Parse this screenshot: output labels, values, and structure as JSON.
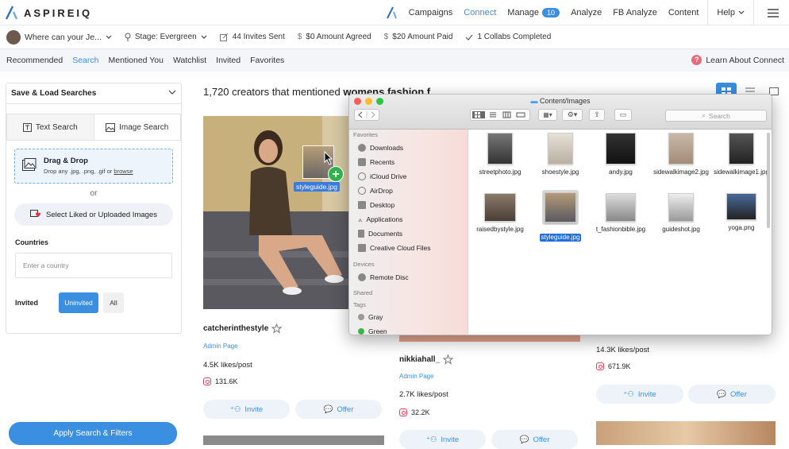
{
  "brand": {
    "name": "ASPIREIQ",
    "accent": "#3a8fe0"
  },
  "nav": {
    "items": [
      {
        "label": "Campaigns",
        "active": false
      },
      {
        "label": "Connect",
        "active": true
      },
      {
        "label": "Manage",
        "badge": "10"
      },
      {
        "label": "Analyze"
      },
      {
        "label": "FB Analyze"
      },
      {
        "label": "Content"
      },
      {
        "label": "Help"
      }
    ]
  },
  "subbar": {
    "campaign": "Where can your Je...",
    "stage": "Stage: Evergreen",
    "invites": "44 Invites Sent",
    "agreed": "$0 Amount Agreed",
    "paid": "$20 Amount Paid",
    "collabs": "1 Collabs Completed"
  },
  "tabs": [
    "Recommended",
    "Search",
    "Mentioned You",
    "Watchlist",
    "Invited",
    "Favorites"
  ],
  "active_tab": "Search",
  "learn": "Learn About Connect",
  "left": {
    "save_load": "Save & Load Searches",
    "text_search": "Text Search",
    "image_search": "Image Search",
    "drop_title": "Drag & Drop",
    "drop_sub": "Drop any .jpg, .png, .gif or",
    "drop_link": "browse",
    "or": "or",
    "select_btn": "Select Liked or Uploaded Images",
    "countries_label": "Countries",
    "country_placeholder": "Enter a country",
    "invited_label": "Invited",
    "uninvited": "Uninvited",
    "all": "All",
    "apply": "Apply Search & Filters"
  },
  "results": {
    "title_prefix": "1,720 creators that mentioned ",
    "title_bold": "womens fashion f",
    "cards": [
      {
        "name": "catcherinthestyle",
        "admin": "Admin Page",
        "likes": "4.5K likes/post",
        "followers": "131.6K",
        "invite": "Invite",
        "offer": "Offer"
      },
      {
        "name": "nikkiahall_",
        "admin": "Admin Page",
        "likes": "2.7K likes/post",
        "followers": "32.2K",
        "invite": "Invite",
        "offer": "Offer"
      },
      {
        "likes": "14.3K likes/post",
        "followers": "671.9K",
        "invite": "Invite",
        "offer": "Offer"
      }
    ]
  },
  "drag_label": "styleguide.jpg",
  "finder": {
    "title": "Content/Images",
    "search_placeholder": "Search",
    "sections": {
      "favorites": "Favorites",
      "devices": "Devices",
      "shared": "Shared",
      "tags": "Tags"
    },
    "favorites": [
      "Downloads",
      "Recents",
      "iCloud Drive",
      "AirDrop",
      "Desktop",
      "Applications",
      "Documents",
      "Creative Cloud Files"
    ],
    "devices": [
      "Remote Disc"
    ],
    "tags": [
      "Gray",
      "Green"
    ],
    "files": [
      {
        "name": "streetphoto.jpg"
      },
      {
        "name": "shoestyle.jpg"
      },
      {
        "name": "andy.jpg"
      },
      {
        "name": "sidewalkimage2.jpg"
      },
      {
        "name": "sidewalkimage1.jpg"
      },
      {
        "name": "raisedbystyle.jpg"
      },
      {
        "name": "styleguide.jpg",
        "selected": true
      },
      {
        "name": "t_fashionbible.jpg"
      },
      {
        "name": "guideshot.jpg"
      },
      {
        "name": "yoga.png"
      }
    ]
  }
}
